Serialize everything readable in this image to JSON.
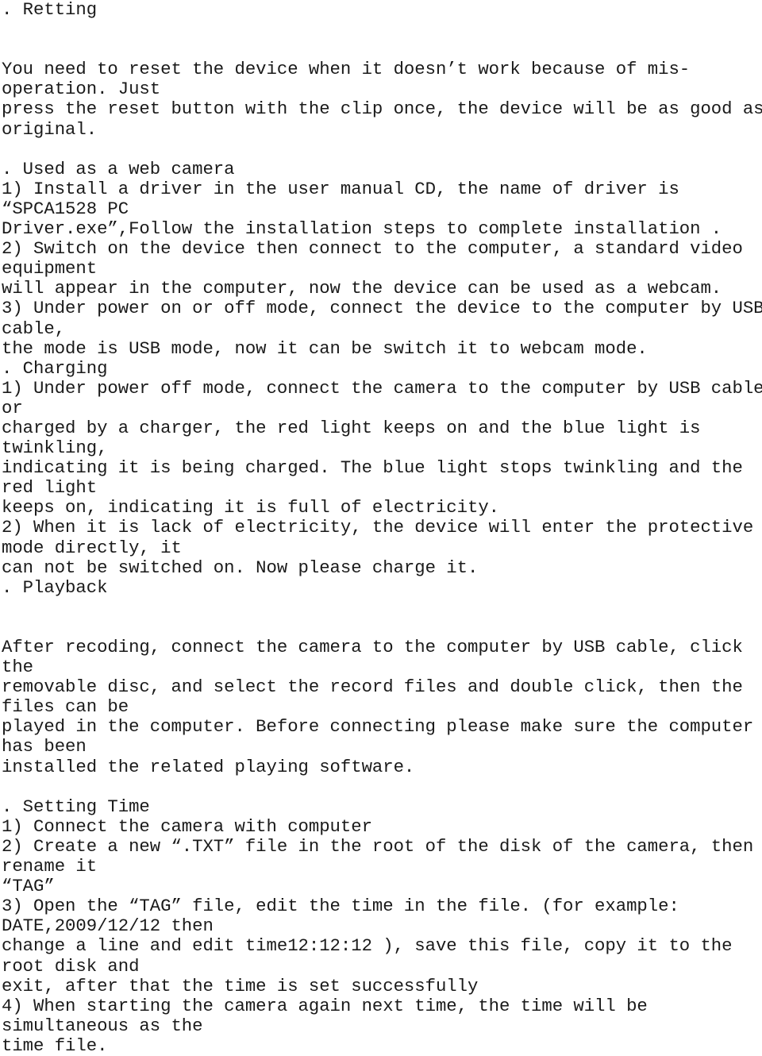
{
  "document": {
    "text_color": "#1a1a1a",
    "background_color": "#ffffff",
    "sections": [
      {
        "id": "resetting",
        "heading": ". Retting",
        "lines": [
          "You need to reset the device when it doesn’t work because of mis-",
          "operation. Just",
          "press the reset button with the clip once, the device will be as good as",
          "original."
        ]
      },
      {
        "id": "web-camera",
        "heading": ". Used as a web camera",
        "lines": [
          "1) Install a driver in the user manual CD, the name of driver is",
          "“SPCA1528 PC",
          "Driver.exe”,Follow the installation steps to complete installation .",
          "2) Switch on the device then connect to the computer, a standard video",
          "equipment",
          "will appear in the computer, now the device can be used as a webcam.",
          "3) Under power on or off mode, connect the device to the computer by USB",
          "cable,",
          "the mode is USB mode, now it can be switch it to webcam mode."
        ]
      },
      {
        "id": "charging",
        "heading": ". Charging",
        "lines": [
          "1) Under power off mode, connect the camera to the computer by USB cable",
          "or",
          "charged by a charger, the red light keeps on and the blue light is",
          "twinkling,",
          "indicating it is being charged. The blue light stops twinkling and the",
          "red light",
          "keeps on, indicating it is full of electricity.",
          "2) When it is lack of electricity, the device will enter the protective",
          "mode directly, it",
          "can not be switched on. Now please charge it."
        ]
      },
      {
        "id": "playback",
        "heading": ". Playback",
        "lines": [
          "After recoding, connect the camera to the computer by USB cable, click",
          "the",
          "removable disc, and select the record files and double click, then the",
          "files can be",
          "played in the computer. Before connecting please make sure the computer",
          "has been",
          "installed the related playing software."
        ]
      },
      {
        "id": "setting-time",
        "heading": ". Setting Time",
        "lines": [
          "1) Connect the camera with computer",
          "2) Create a new “.TXT” file in the root of the disk of the camera, then",
          "rename it",
          "“TAG”",
          "3) Open the “TAG” file, edit the time in the file. (for example:",
          "DATE,2009/12/12 then",
          "change a line and edit time12:12:12 ), save this file, copy it to the",
          "root disk and",
          "exit, after that the time is set successfully",
          "4) When starting the camera again next time, the time will be",
          "simultaneous as the",
          "time file."
        ]
      }
    ],
    "rendered_lines": [
      ". Retting",
      "",
      "",
      "You need to reset the device when it doesn’t work because of mis-",
      "operation. Just",
      "press the reset button with the clip once, the device will be as good as",
      "original.",
      "",
      ". Used as a web camera",
      "1) Install a driver in the user manual CD, the name of driver is",
      "“SPCA1528 PC",
      "Driver.exe”,Follow the installation steps to complete installation .",
      "2) Switch on the device then connect to the computer, a standard video",
      "equipment",
      "will appear in the computer, now the device can be used as a webcam.",
      "3) Under power on or off mode, connect the device to the computer by USB",
      "cable,",
      "the mode is USB mode, now it can be switch it to webcam mode.",
      ". Charging",
      "1) Under power off mode, connect the camera to the computer by USB cable",
      "or",
      "charged by a charger, the red light keeps on and the blue light is",
      "twinkling,",
      "indicating it is being charged. The blue light stops twinkling and the",
      "red light",
      "keeps on, indicating it is full of electricity.",
      "2) When it is lack of electricity, the device will enter the protective",
      "mode directly, it",
      "can not be switched on. Now please charge it.",
      ". Playback",
      "",
      "",
      "After recoding, connect the camera to the computer by USB cable, click",
      "the",
      "removable disc, and select the record files and double click, then the",
      "files can be",
      "played in the computer. Before connecting please make sure the computer",
      "has been",
      "installed the related playing software.",
      "",
      ". Setting Time",
      "1) Connect the camera with computer",
      "2) Create a new “.TXT” file in the root of the disk of the camera, then",
      "rename it",
      "“TAG”",
      "3) Open the “TAG” file, edit the time in the file. (for example:",
      "DATE,2009/12/12 then",
      "change a line and edit time12:12:12 ), save this file, copy it to the",
      "root disk and",
      "exit, after that the time is set successfully",
      "4) When starting the camera again next time, the time will be",
      "simultaneous as the",
      "time file."
    ]
  }
}
